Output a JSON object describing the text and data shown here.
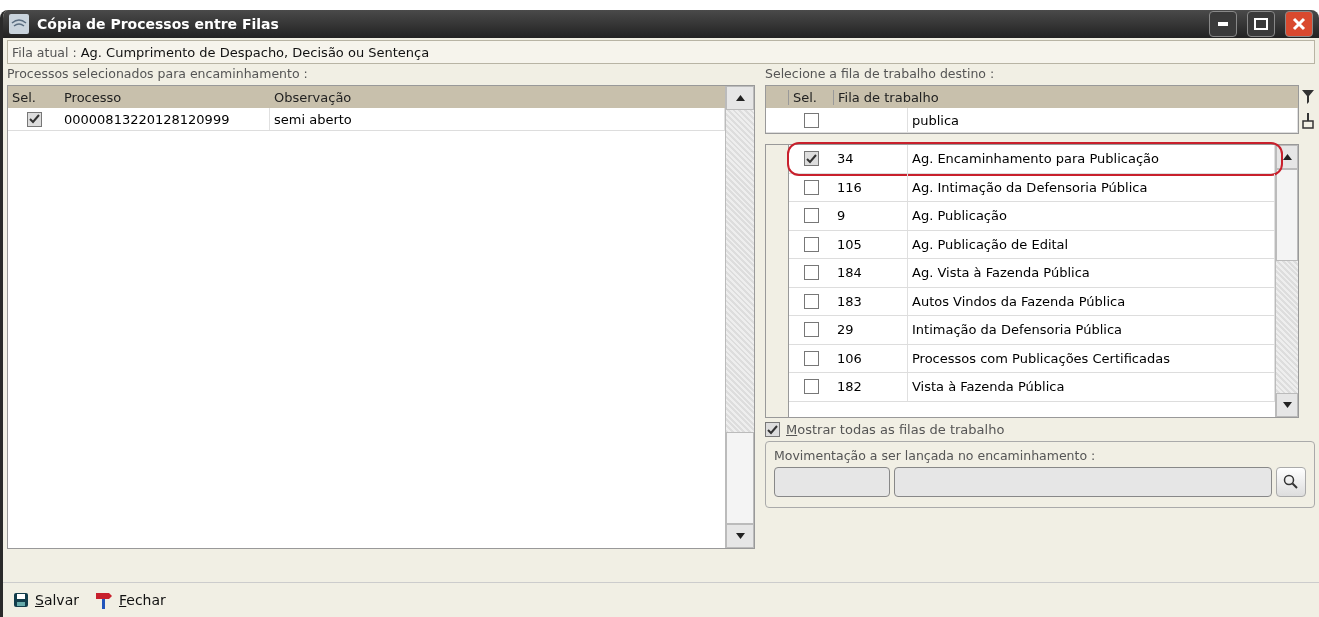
{
  "window": {
    "title": "Cópia de Processos entre Filas"
  },
  "current_queue": {
    "label": "Fila atual :",
    "value": "Ag. Cumprimento de Despacho, Decisão ou Sentença"
  },
  "selected_processes": {
    "label": "Processos selecionados para encaminhamento :",
    "columns": [
      "Sel.",
      "Processo",
      "Observação"
    ],
    "rows": [
      {
        "checked": true,
        "processo": "00000813220128120999",
        "observacao": "semi aberto"
      }
    ]
  },
  "destination": {
    "label": "Selecione a fila de trabalho destino :",
    "columns": [
      "Sel.",
      "Fila de trabalho"
    ],
    "filter": {
      "checked": false,
      "value": "publica"
    },
    "rows": [
      {
        "checked": true,
        "highlighted": true,
        "code": "34",
        "name": "Ag. Encaminhamento para Publicação"
      },
      {
        "checked": false,
        "highlighted": false,
        "code": "116",
        "name": "Ag. Intimação da Defensoria Pública"
      },
      {
        "checked": false,
        "highlighted": false,
        "code": "9",
        "name": "Ag. Publicação"
      },
      {
        "checked": false,
        "highlighted": false,
        "code": "105",
        "name": "Ag. Publicação de Edital"
      },
      {
        "checked": false,
        "highlighted": false,
        "code": "184",
        "name": "Ag. Vista à Fazenda Pública"
      },
      {
        "checked": false,
        "highlighted": false,
        "code": "183",
        "name": "Autos Vindos da Fazenda Pública"
      },
      {
        "checked": false,
        "highlighted": false,
        "code": "29",
        "name": "Intimação da Defensoria Pública"
      },
      {
        "checked": false,
        "highlighted": false,
        "code": "106",
        "name": "Processos com Publicações Certificadas"
      },
      {
        "checked": false,
        "highlighted": false,
        "code": "182",
        "name": "Vista à Fazenda Pública"
      }
    ]
  },
  "show_all": {
    "label": "Mostrar todas as filas de trabalho",
    "checked": true
  },
  "movement": {
    "label": "Movimentação a ser lançada no encaminhamento :"
  },
  "footer": {
    "buttons": [
      "Salvar",
      "Fechar"
    ]
  }
}
